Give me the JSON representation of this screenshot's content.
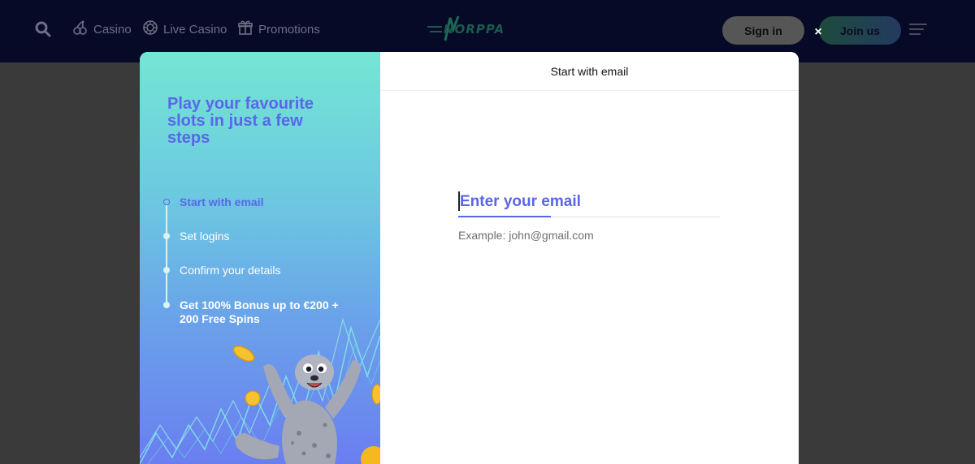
{
  "nav": {
    "casino_label": "Casino",
    "live_casino_label": "Live Casino",
    "promotions_label": "Promotions",
    "logo_text": "NORPPA",
    "signin_label": "Sign in",
    "join_label": "Join us",
    "close_label": "×"
  },
  "promo": {
    "title": "Play your favourite slots in just a few steps",
    "steps": [
      {
        "label": "Start with email",
        "state": "active"
      },
      {
        "label": "Set logins",
        "state": "pending"
      },
      {
        "label": "Confirm your details",
        "state": "pending"
      },
      {
        "label": "Get 100% Bonus up to €200 + 200 Free Spins",
        "state": "pending"
      }
    ]
  },
  "form": {
    "header": "Start with email",
    "email_placeholder": "Enter your email",
    "email_value": "",
    "hint": "Example: john@gmail.com"
  },
  "colors": {
    "nav_bg": "#060a26",
    "accent": "#5a66e8",
    "panel_top": "#74e6d4",
    "panel_bottom": "#6a7ef0"
  }
}
